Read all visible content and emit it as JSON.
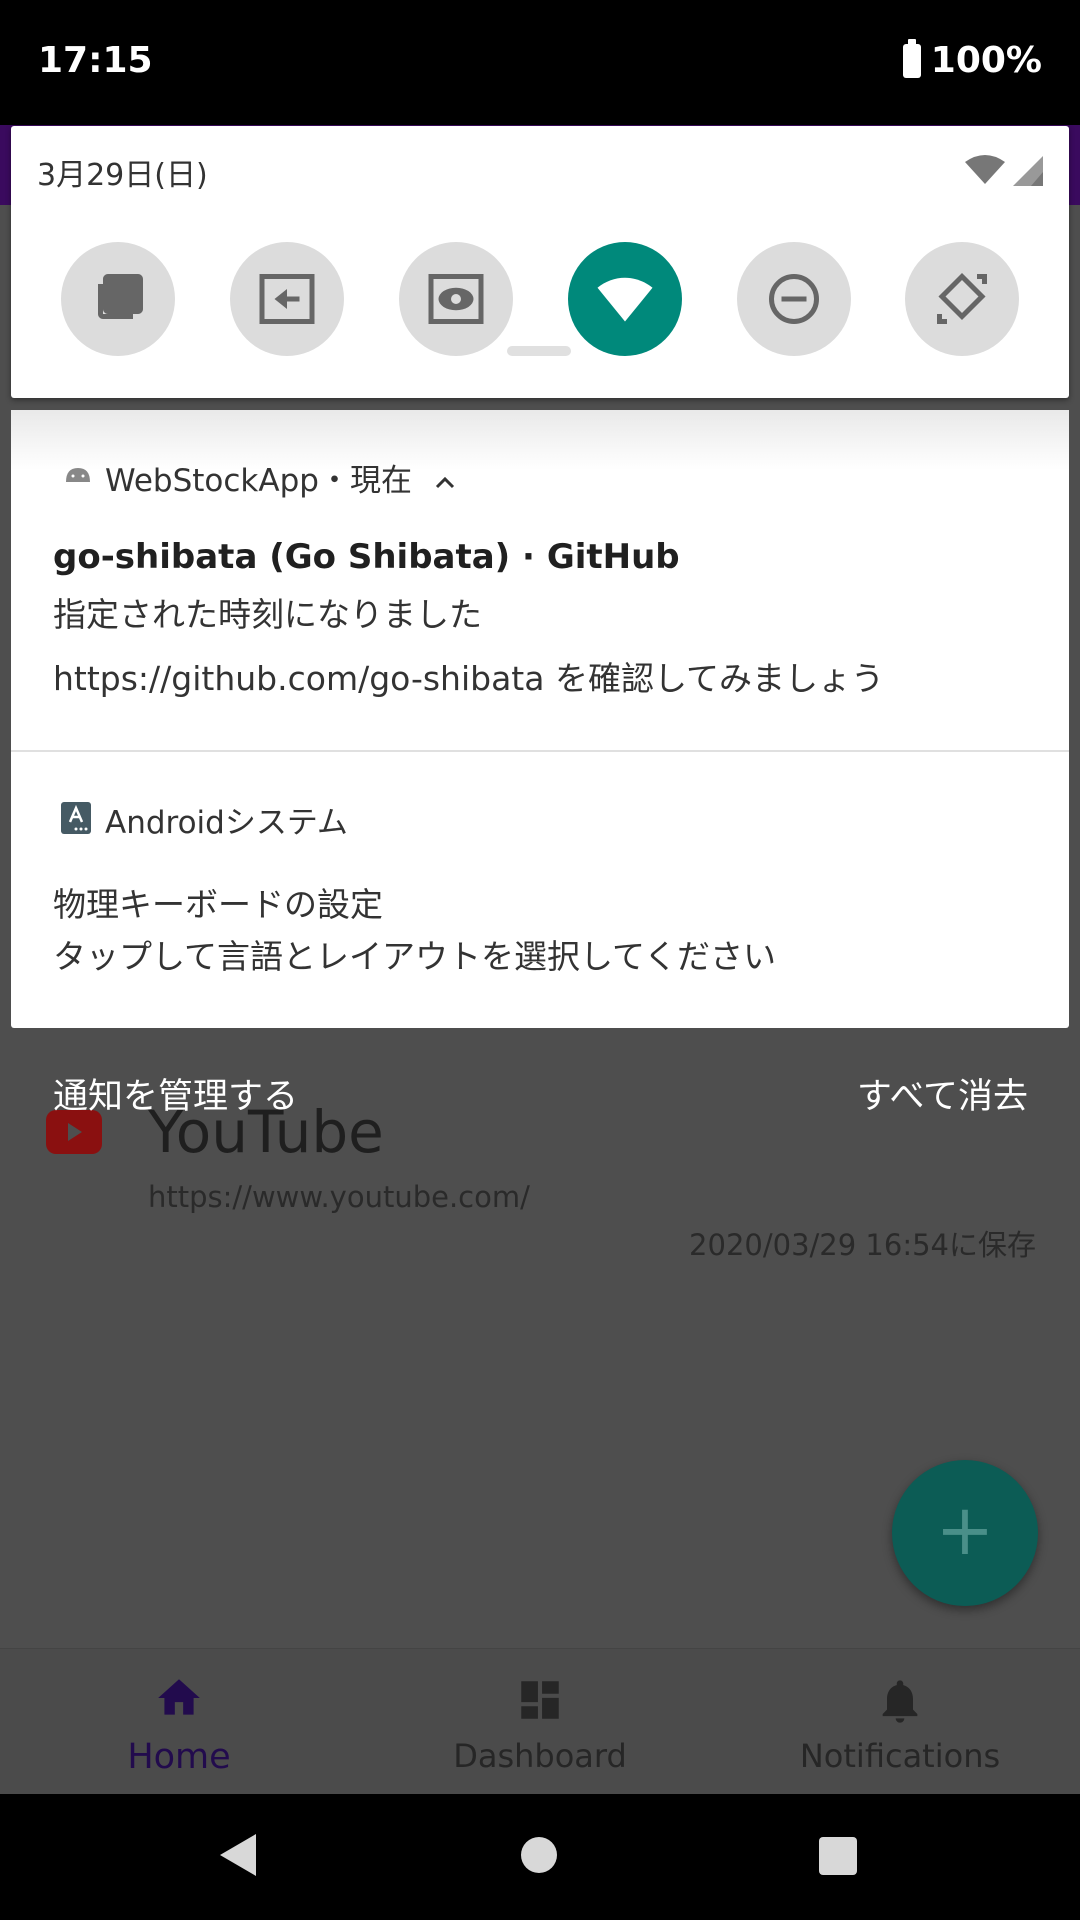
{
  "status_bar": {
    "time": "17:15",
    "battery": "100%"
  },
  "quick_settings": {
    "date": "3月29日(日)",
    "tiles": [
      {
        "icon": "copy-icon",
        "state": "off"
      },
      {
        "icon": "input-icon",
        "state": "off"
      },
      {
        "icon": "screen-eye-icon",
        "state": "off"
      },
      {
        "icon": "wifi-icon",
        "state": "on"
      },
      {
        "icon": "do-not-disturb-icon",
        "state": "off"
      },
      {
        "icon": "auto-rotate-icon",
        "state": "off"
      }
    ],
    "active_color": "#00897b"
  },
  "notifications": [
    {
      "app": "WebStockApp・現在",
      "title": "go-shibata (Go Shibata) · GitHub",
      "subtitle": "指定された時刻になりました",
      "body": "https://github.com/go-shibata を確認してみましょう"
    },
    {
      "app": "Androidシステム",
      "title": "物理キーボードの設定",
      "body": "タップして言語とレイアウトを選択してください"
    }
  ],
  "shade_actions": {
    "manage": "通知を管理する",
    "clear_all": "すべて消去"
  },
  "background_app": {
    "item_title": "YouTube",
    "item_url": "https://www.youtube.com/",
    "item_saved": "2020/03/29 16:54に保存",
    "fab_label": "+",
    "nav": [
      {
        "label": "Home",
        "active": true
      },
      {
        "label": "Dashboard",
        "active": false
      },
      {
        "label": "Notifications",
        "active": false
      }
    ]
  }
}
